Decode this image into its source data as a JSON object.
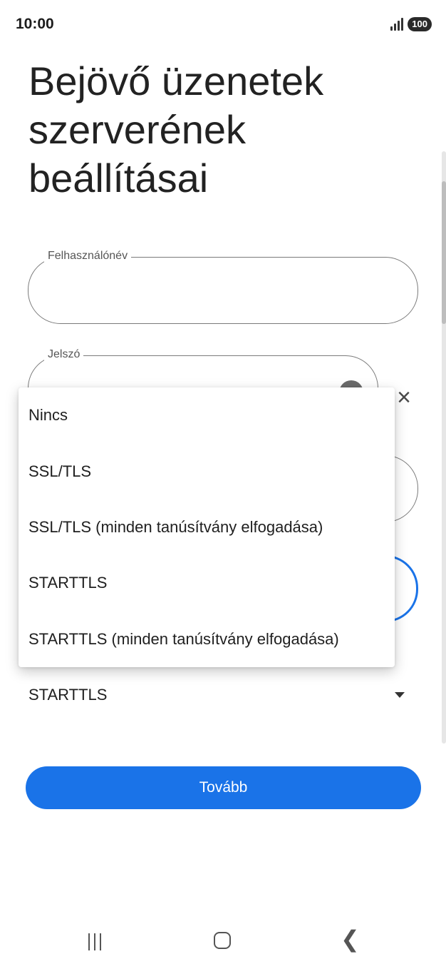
{
  "status_bar": {
    "time": "10:00",
    "battery": "100",
    "signal_icon": "signal-bars-icon"
  },
  "page": {
    "title": "Bejövő üzenetek szerverének beállításai"
  },
  "form": {
    "username_label": "Felhasználónév",
    "username_value": "",
    "password_label": "Jelszó",
    "password_value": "",
    "security_value": "STARTTLS"
  },
  "dropdown": {
    "options": [
      "Nincs",
      "SSL/TLS",
      "SSL/TLS (minden tanúsítvány elfogadása)",
      "STARTTLS",
      "STARTTLS (minden tanúsítvány elfogadása)"
    ]
  },
  "actions": {
    "continue_label": "Tovább"
  },
  "colors": {
    "accent": "#1a73e8",
    "background": "#ffffff"
  }
}
